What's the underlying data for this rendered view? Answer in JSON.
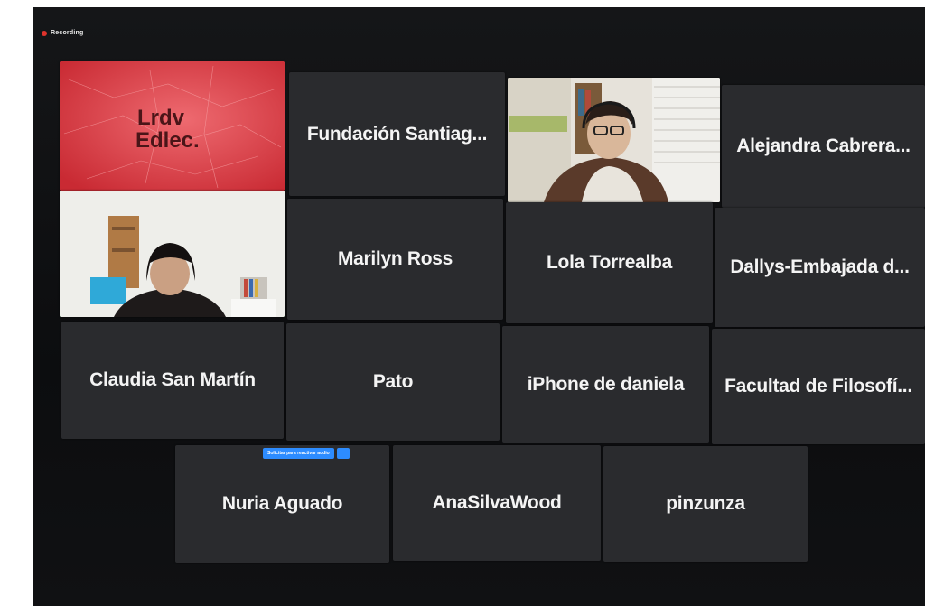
{
  "recording": {
    "label": "Recording"
  },
  "logo_tile": {
    "logo_text": "Lrdv Edlec."
  },
  "participants": [
    "Fundación Santiag...",
    "Alejandra Cabrera...",
    "Marilyn Ross",
    "Lola Torrealba",
    "Dallys-Embajada d...",
    "Claudia San Martín",
    "Pato",
    "iPhone de daniela",
    "Facultad de Filosofí...",
    "Nuria Aguado",
    "AnaSilvaWood",
    "pinzunza"
  ],
  "unmute_request": {
    "label": "Solicitar para reactivar audio",
    "more": "···"
  },
  "colors": {
    "active_speaker": "#3fbf4a",
    "recording": "#e0332c",
    "button": "#2d8cff",
    "tile": "#2a2b2e"
  }
}
